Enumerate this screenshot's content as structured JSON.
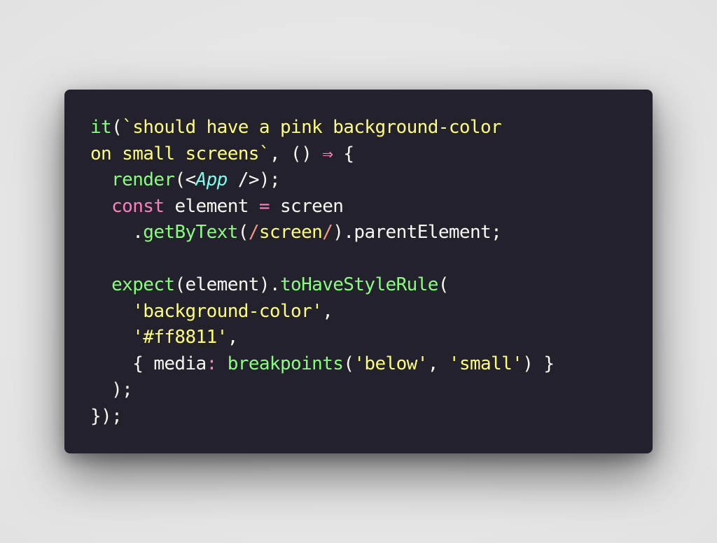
{
  "colors": {
    "background": "#e6e6e6",
    "editor_background": "#22212c",
    "plain": "#f8f8f2",
    "function": "#8aff80",
    "string": "#ffff80",
    "keyword": "#ff80bf",
    "component": "#80ffea",
    "regex_delimiter": "#ff9580"
  },
  "code": {
    "language": "javascript",
    "lines": [
      [
        {
          "t": "it",
          "k": "fn"
        },
        {
          "t": "(",
          "k": "plain"
        },
        {
          "t": "`should have a pink background-color",
          "k": "str"
        }
      ],
      [
        {
          "t": "on small screens`",
          "k": "str"
        },
        {
          "t": ", () ",
          "k": "plain"
        },
        {
          "t": "⇒",
          "k": "kw"
        },
        {
          "t": " {",
          "k": "plain"
        }
      ],
      [
        {
          "t": "  ",
          "k": "plain"
        },
        {
          "t": "render",
          "k": "fn"
        },
        {
          "t": "(<",
          "k": "plain"
        },
        {
          "t": "App",
          "k": "comp"
        },
        {
          "t": " />);",
          "k": "plain"
        }
      ],
      [
        {
          "t": "  ",
          "k": "plain"
        },
        {
          "t": "const",
          "k": "kw"
        },
        {
          "t": " element ",
          "k": "plain"
        },
        {
          "t": "=",
          "k": "kw"
        },
        {
          "t": " screen",
          "k": "plain"
        }
      ],
      [
        {
          "t": "    .",
          "k": "plain"
        },
        {
          "t": "getByText",
          "k": "fn"
        },
        {
          "t": "(",
          "k": "plain"
        },
        {
          "t": "/",
          "k": "regex"
        },
        {
          "t": "screen",
          "k": "str"
        },
        {
          "t": "/",
          "k": "regex"
        },
        {
          "t": ").parentElement;",
          "k": "plain"
        }
      ],
      [
        {
          "t": "",
          "k": "plain"
        }
      ],
      [
        {
          "t": "  ",
          "k": "plain"
        },
        {
          "t": "expect",
          "k": "fn"
        },
        {
          "t": "(element).",
          "k": "plain"
        },
        {
          "t": "toHaveStyleRule",
          "k": "fn"
        },
        {
          "t": "(",
          "k": "plain"
        }
      ],
      [
        {
          "t": "    ",
          "k": "plain"
        },
        {
          "t": "'background-color'",
          "k": "str"
        },
        {
          "t": ",",
          "k": "plain"
        }
      ],
      [
        {
          "t": "    ",
          "k": "plain"
        },
        {
          "t": "'#ff8811'",
          "k": "str"
        },
        {
          "t": ",",
          "k": "plain"
        }
      ],
      [
        {
          "t": "    { media",
          "k": "plain"
        },
        {
          "t": ":",
          "k": "kw"
        },
        {
          "t": " ",
          "k": "plain"
        },
        {
          "t": "breakpoints",
          "k": "fn"
        },
        {
          "t": "(",
          "k": "plain"
        },
        {
          "t": "'below'",
          "k": "str"
        },
        {
          "t": ", ",
          "k": "plain"
        },
        {
          "t": "'small'",
          "k": "str"
        },
        {
          "t": ") }",
          "k": "plain"
        }
      ],
      [
        {
          "t": "  );",
          "k": "plain"
        }
      ],
      [
        {
          "t": "});",
          "k": "plain"
        }
      ]
    ]
  }
}
